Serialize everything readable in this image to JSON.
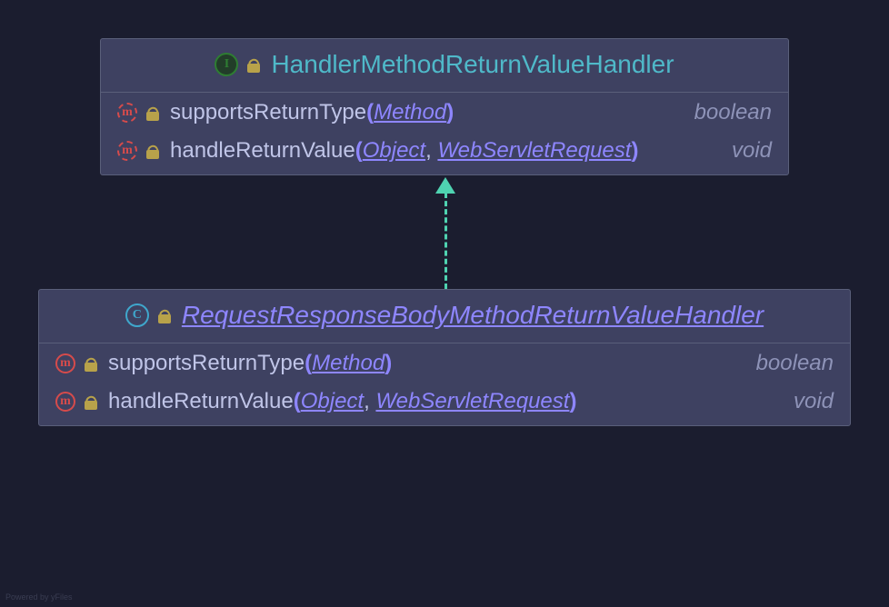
{
  "interfaceBox": {
    "iconLetter": "I",
    "name": "HandlerMethodReturnValueHandler",
    "members": [
      {
        "iconLetter": "m",
        "name": "supportsReturnType",
        "params": [
          "Method"
        ],
        "returnType": "boolean"
      },
      {
        "iconLetter": "m",
        "name": "handleReturnValue",
        "params": [
          "Object",
          "WebServletRequest"
        ],
        "returnType": "void"
      }
    ]
  },
  "classBox": {
    "iconLetter": "C",
    "name": "RequestResponseBodyMethodReturnValueHandler",
    "members": [
      {
        "iconLetter": "m",
        "name": "supportsReturnType",
        "params": [
          "Method"
        ],
        "returnType": "boolean"
      },
      {
        "iconLetter": "m",
        "name": "handleReturnValue",
        "params": [
          "Object",
          "WebServletRequest"
        ],
        "returnType": "void"
      }
    ]
  },
  "watermark": "Powered by yFiles"
}
